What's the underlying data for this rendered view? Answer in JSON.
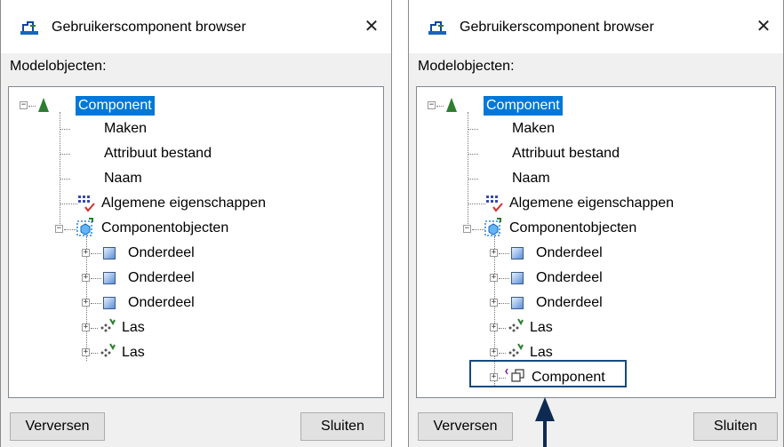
{
  "windows": [
    {
      "title": "Gebruikerscomponent browser",
      "close_glyph": "✕",
      "section_label": "Modelobjecten:",
      "tree": {
        "root": "Component",
        "children": [
          "Maken",
          "Attribuut bestand",
          "Naam",
          "Algemene eigenschappen",
          "Componentobjecten"
        ],
        "objects": [
          "Onderdeel",
          "Onderdeel",
          "Onderdeel",
          "Las",
          "Las"
        ]
      },
      "buttons": {
        "refresh": "Verversen",
        "close": "Sluiten"
      }
    },
    {
      "title": "Gebruikerscomponent browser",
      "close_glyph": "✕",
      "section_label": "Modelobjecten:",
      "tree": {
        "root": "Component",
        "children": [
          "Maken",
          "Attribuut bestand",
          "Naam",
          "Algemene eigenschappen",
          "Componentobjecten"
        ],
        "objects": [
          "Onderdeel",
          "Onderdeel",
          "Onderdeel",
          "Las",
          "Las",
          "Component"
        ]
      },
      "buttons": {
        "refresh": "Verversen",
        "close": "Sluiten"
      }
    }
  ],
  "icons": {
    "app": "tekla-app-icon",
    "root": "component-triangle-icon",
    "attributes": "properties-grid-icon",
    "objects_group": "component-objects-icon",
    "part": "part-cube-icon",
    "weld": "weld-icon",
    "sub_component": "sub-component-icon"
  },
  "annotation": {
    "highlight_color": "#154a7e",
    "arrow_color": "#0d2a52"
  },
  "colors": {
    "selection": "#0078d7",
    "window_bg": "#f0f0f0"
  }
}
